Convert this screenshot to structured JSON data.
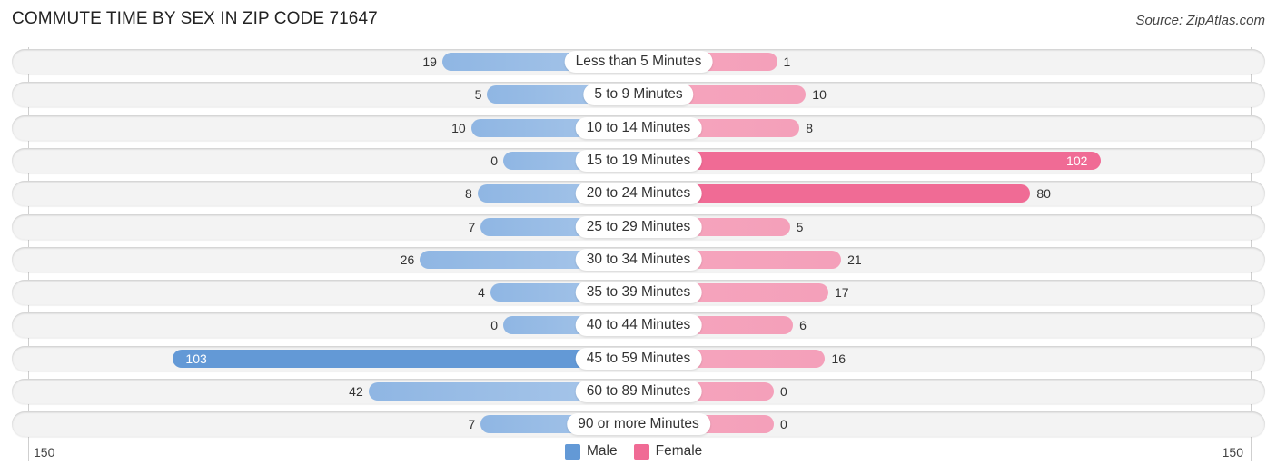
{
  "chart_data": {
    "type": "bar",
    "orientation": "horizontal-diverging",
    "title": "COMMUTE TIME BY SEX IN ZIP CODE 71647",
    "source": "Source: ZipAtlas.com",
    "categories": [
      "Less than 5 Minutes",
      "5 to 9 Minutes",
      "10 to 14 Minutes",
      "15 to 19 Minutes",
      "20 to 24 Minutes",
      "25 to 29 Minutes",
      "30 to 34 Minutes",
      "35 to 39 Minutes",
      "40 to 44 Minutes",
      "45 to 59 Minutes",
      "60 to 89 Minutes",
      "90 or more Minutes"
    ],
    "series": [
      {
        "name": "Male",
        "color": "#6399d6",
        "values": [
          19,
          5,
          10,
          0,
          8,
          7,
          26,
          4,
          0,
          103,
          42,
          7
        ]
      },
      {
        "name": "Female",
        "color": "#f06b95",
        "values": [
          1,
          10,
          8,
          102,
          80,
          5,
          21,
          17,
          6,
          16,
          0,
          0
        ]
      }
    ],
    "axis": {
      "left_label": "150",
      "right_label": "150",
      "max": 150
    },
    "legend": [
      "Male",
      "Female"
    ],
    "legend_position": "bottom-center"
  }
}
